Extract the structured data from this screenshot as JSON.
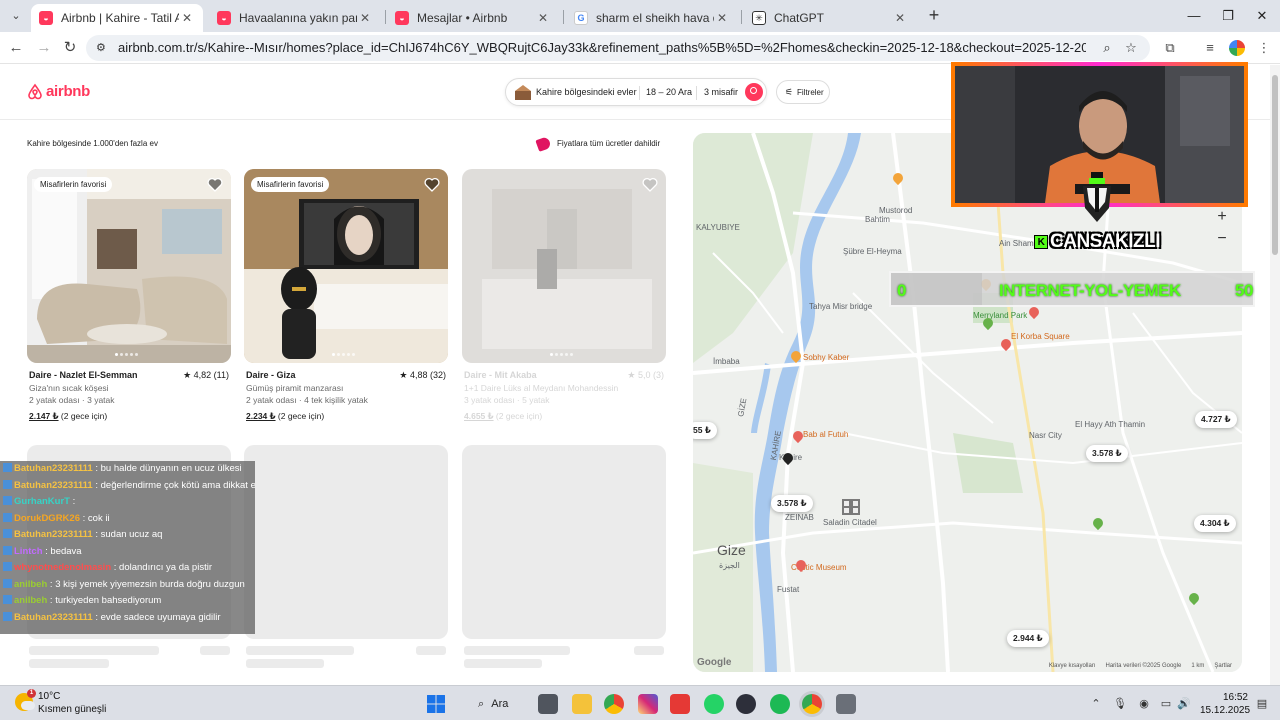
{
  "browser": {
    "tabs": [
      {
        "title": "Airbnb | Kahire - Tatil Amaçlı Kiralık",
        "active": true
      },
      {
        "title": "Havaalanına yakın panoramik manzaralı"
      },
      {
        "title": "Mesajlar • Airbnb"
      },
      {
        "title": "sharm el sheikh hava durumu - Google"
      },
      {
        "title": "ChatGPT"
      }
    ],
    "url": "airbnb.com.tr/s/Kahire--Mısır/homes?place_id=ChIJ674hC6Y_WBQRujtC6Jay33k&refinement_paths%5B%5D=%2Fhomes&checkin=2025-12-18&checkout=2025-12-20&date_picker_type=calendar&query=Kahi..."
  },
  "airbnb": {
    "logo": "airbnb",
    "search": {
      "location": "Kahire bölgesindeki evler",
      "dates": "18 – 20 Ara",
      "guests": "3 misafir"
    },
    "filters_label": "Filtreler",
    "results_count": "Kahire bölgesinde 1.000'den fazla ev",
    "price_note": "Fiyatlara tüm ücretler dahildir",
    "listings": [
      {
        "badge": "Misafirlerin favorisi",
        "title": "Daire - Nazlet El-Semman",
        "rating": "★ 4,82 (11)",
        "subtitle": "Giza'nın sıcak köşesi",
        "beds": "2 yatak odası · 3 yatak",
        "price": "2.147 ₺",
        "price_note": " (2 gece için)"
      },
      {
        "badge": "Misafirlerin favorisi",
        "title": "Daire - Giza",
        "rating": "★ 4,88 (32)",
        "subtitle": "Gümüş piramit manzarası",
        "beds": "2 yatak odası · 4 tek kişilik yatak",
        "price": "2.234 ₺",
        "price_note": " (2 gece için)"
      },
      {
        "badge": "",
        "title": "Daire - Mit Akaba",
        "rating": "★ 5,0 (3)",
        "subtitle": "1+1 Daire Lüks al Meydanı Mohandessin",
        "beds": "3 yatak odası · 5 yatak",
        "price": "4.655 ₺",
        "price_note": " (2 gece için)"
      }
    ]
  },
  "map": {
    "labels": [
      {
        "text": "Mustorod"
      },
      {
        "text": "Bahtim"
      },
      {
        "text": "KALYUBIYE"
      },
      {
        "text": "Şübre El-Heyma"
      },
      {
        "text": "Ain Shams"
      },
      {
        "text": "Merryland Park"
      },
      {
        "text": "El Korba Square"
      },
      {
        "text": "Tahya Misr bridge"
      },
      {
        "text": "İmbaba"
      },
      {
        "text": "Sobhy Kaber"
      },
      {
        "text": "El Hayy Ath Thamin"
      },
      {
        "text": "Nasr City"
      },
      {
        "text": "Bab al Futuh"
      },
      {
        "text": "Kahire"
      },
      {
        "text": "Saladin Citadel"
      },
      {
        "text": "Gize"
      },
      {
        "text": "الجيزة"
      },
      {
        "text": "Coptic Museum"
      },
      {
        "text": "Fustat"
      },
      {
        "text": "KAHİRE"
      },
      {
        "text": "GİZE"
      },
      {
        "text": "ZEINAB"
      }
    ],
    "prices": [
      "4.727 ₺",
      "3.578 ₺",
      "55 ₺",
      "3.578 ₺",
      "4.304 ₺",
      "2.944 ₺"
    ],
    "footer": [
      "Klavye kısayolları",
      "Harita verileri ©2025 Google",
      "1 km",
      "Şartlar"
    ],
    "google": "Google"
  },
  "stream": {
    "name": "CANSAKIZLI",
    "goal": {
      "start": "0",
      "label": "INTERNET-YOL-YEMEK",
      "end": "50",
      "progress": 0.25
    },
    "chat": [
      {
        "user": "Batuhan23231111",
        "color": "#f5c242",
        "msg": "bu halde dünyanın en ucuz ülkesi"
      },
      {
        "user": "Batuhan23231111",
        "color": "#f5c242",
        "msg": "değerlendirme çok kötü ama dikkat et"
      },
      {
        "user": "GurhanKurT",
        "color": "#36d3c6",
        "msg": ""
      },
      {
        "user": "DorukDGRK26",
        "color": "#f5a623",
        "msg": "cok ii"
      },
      {
        "user": "Batuhan23231111",
        "color": "#f5c242",
        "msg": "sudan ucuz aq"
      },
      {
        "user": "Lintch",
        "color": "#c16bff",
        "msg": "bedava"
      },
      {
        "user": "whynotnedenolmasin",
        "color": "#ff4d4d",
        "msg": "dolandırıcı ya da pistir"
      },
      {
        "user": "anilbeh",
        "color": "#9acd32",
        "msg": "3 kişi yemek yiyemezsin burda doğru duzgun"
      },
      {
        "user": "anilbeh",
        "color": "#9acd32",
        "msg": "turkiyeden bahsediyorum"
      },
      {
        "user": "Batuhan23231111",
        "color": "#f5c242",
        "msg": "evde sadece uyumaya gidilir"
      }
    ]
  },
  "taskbar": {
    "temp": "10°C",
    "condition": "Kısmen güneşli",
    "weather_badge": "1",
    "search": "Ara",
    "time": "16:52",
    "date": "15.12.2025"
  }
}
